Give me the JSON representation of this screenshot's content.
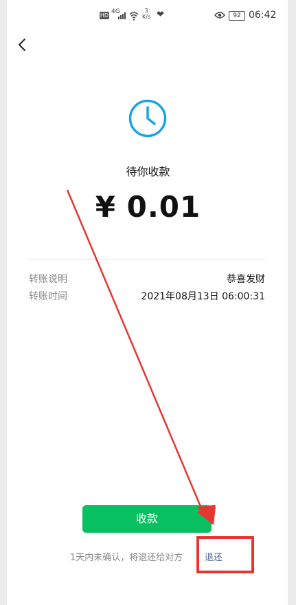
{
  "status_bar": {
    "hd": "HD",
    "network": "4G",
    "speed_top": "3",
    "speed_unit": "K/s",
    "battery": "92",
    "time": "06:42"
  },
  "icons": {
    "back": "chevron-left-icon",
    "clock": "clock-icon"
  },
  "transfer": {
    "status": "待你收款",
    "amount": "¥ 0.01"
  },
  "details": [
    {
      "label": "转账说明",
      "value": "恭喜发财"
    },
    {
      "label": "转账时间",
      "value": "2021年08月13日 06:00:31"
    }
  ],
  "actions": {
    "receive_label": "收款",
    "hint": "1天内未确认，将退还给对方",
    "return_label": "退还"
  },
  "colors": {
    "primary_green": "#07c160",
    "link_blue": "#576b95",
    "annotation_red": "#e8352f",
    "clock_blue": "#1aa4e8"
  }
}
